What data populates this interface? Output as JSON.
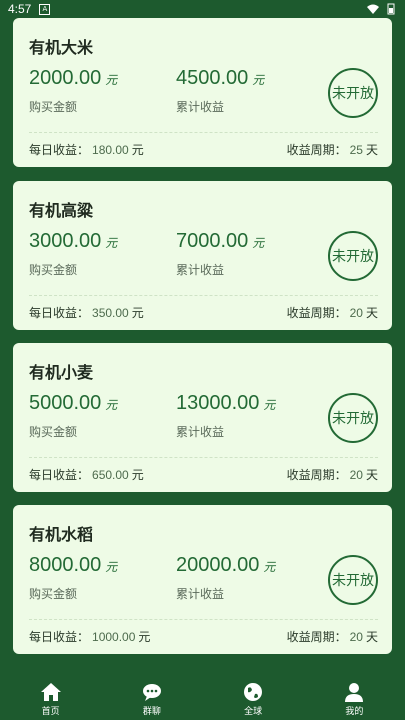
{
  "status": {
    "time": "4:57",
    "a_label": "A"
  },
  "cards": [
    {
      "name": "有机大米",
      "buy_amount": "2000.00",
      "total_income": "4500.00",
      "unit": "元",
      "buy_label": "购买金额",
      "income_label": "累计收益",
      "badge": "未开放",
      "daily_label": "每日收益：",
      "daily_value": "180.00",
      "daily_unit": "元",
      "period_label": "收益周期：",
      "period_value": "25",
      "period_unit": "天"
    },
    {
      "name": "有机高粱",
      "buy_amount": "3000.00",
      "total_income": "7000.00",
      "unit": "元",
      "buy_label": "购买金额",
      "income_label": "累计收益",
      "badge": "未开放",
      "daily_label": "每日收益：",
      "daily_value": "350.00",
      "daily_unit": "元",
      "period_label": "收益周期：",
      "period_value": "20",
      "period_unit": "天"
    },
    {
      "name": "有机小麦",
      "buy_amount": "5000.00",
      "total_income": "13000.00",
      "unit": "元",
      "buy_label": "购买金额",
      "income_label": "累计收益",
      "badge": "未开放",
      "daily_label": "每日收益：",
      "daily_value": "650.00",
      "daily_unit": "元",
      "period_label": "收益周期：",
      "period_value": "20",
      "period_unit": "天"
    },
    {
      "name": "有机水稻",
      "buy_amount": "8000.00",
      "total_income": "20000.00",
      "unit": "元",
      "buy_label": "购买金额",
      "income_label": "累计收益",
      "badge": "未开放",
      "daily_label": "每日收益：",
      "daily_value": "1000.00",
      "daily_unit": "元",
      "period_label": "收益周期：",
      "period_value": "20",
      "period_unit": "天"
    }
  ],
  "tabs": [
    {
      "label": "首页",
      "icon": "home-icon"
    },
    {
      "label": "群聊",
      "icon": "chat-icon"
    },
    {
      "label": "全球",
      "icon": "globe-icon"
    },
    {
      "label": "我的",
      "icon": "user-icon"
    }
  ],
  "colors": {
    "accent": "#236a35",
    "background": "#1d5a2e",
    "card": "#eefbe6"
  }
}
